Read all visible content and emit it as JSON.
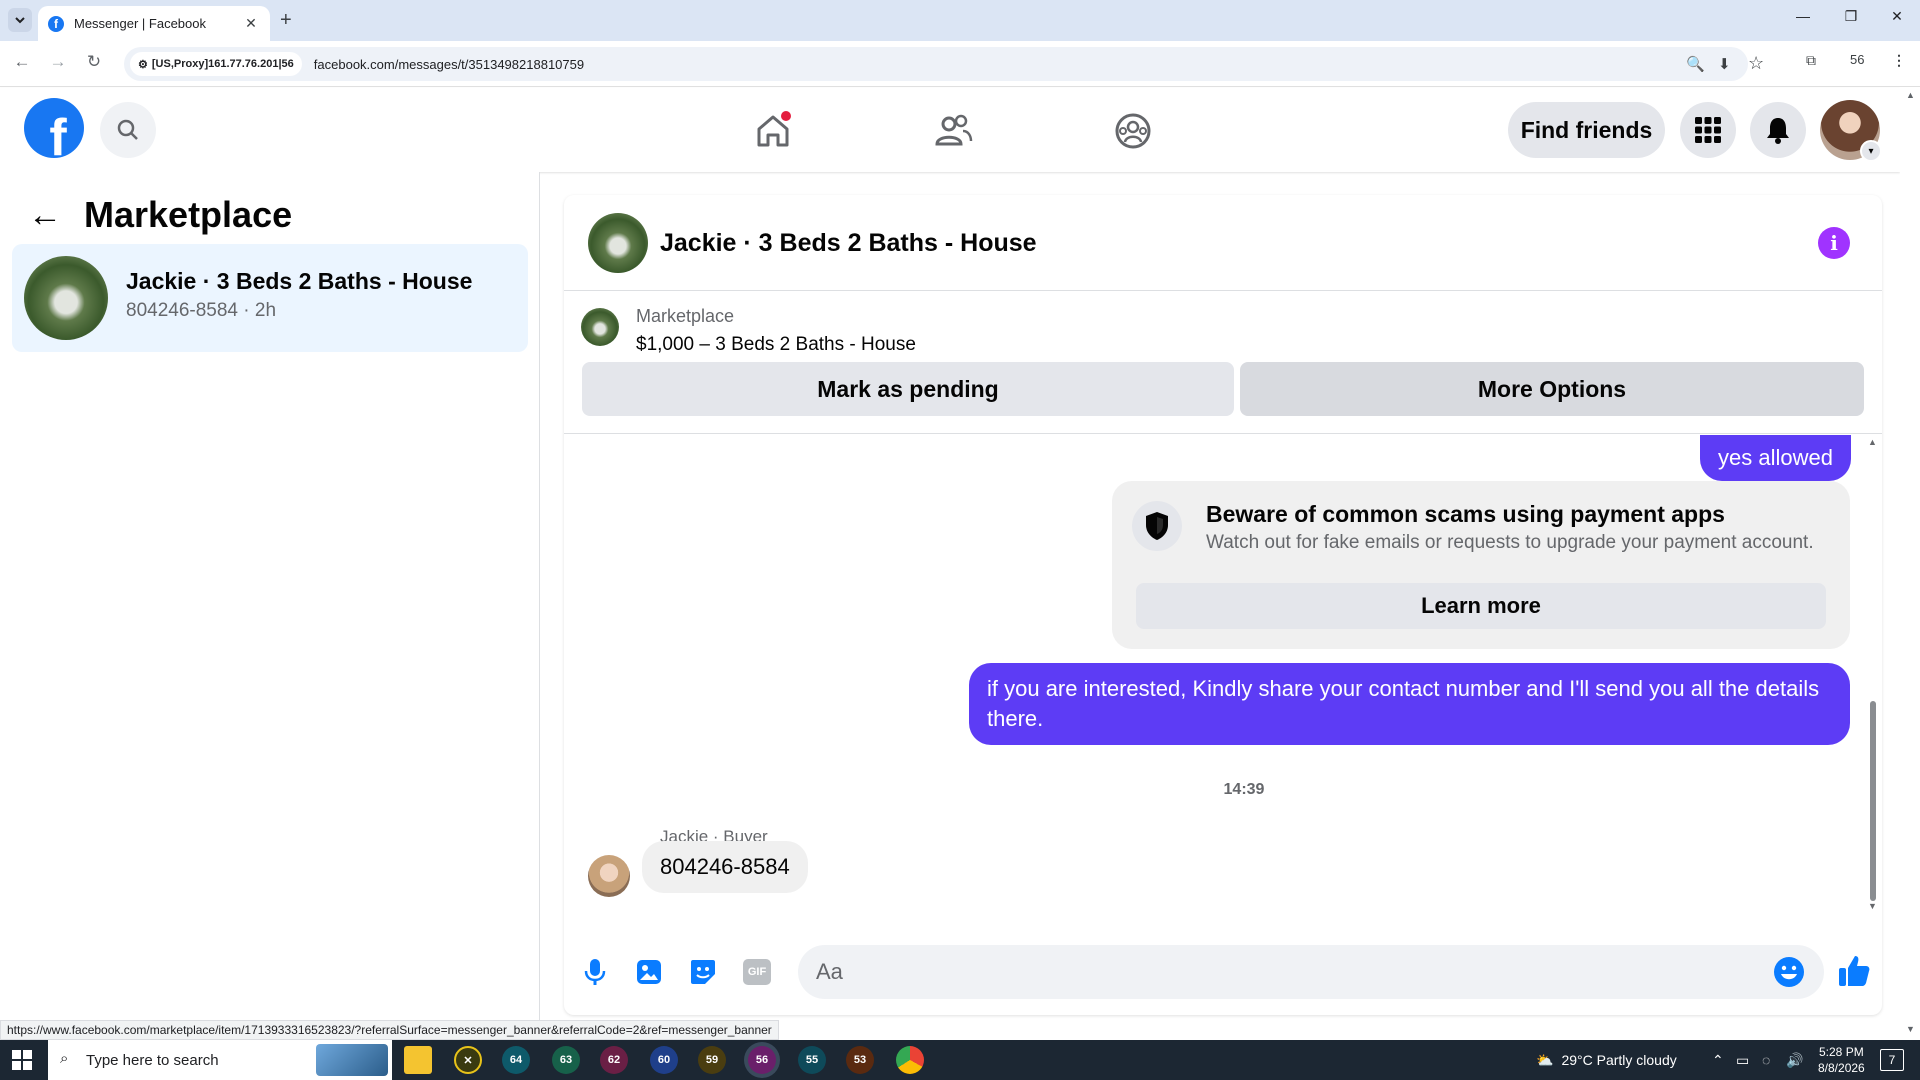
{
  "browser": {
    "tab_title": "Messenger | Facebook",
    "proxy_chip": "[US,Proxy]161.77.76.201|56",
    "url": "facebook.com/messages/t/3513498218810759",
    "profile_count": "56"
  },
  "fb_header": {
    "logo": "f",
    "find_friends": "Find friends"
  },
  "sidebar": {
    "title": "Marketplace",
    "conversation": {
      "name": "Jackie · 3 Beds 2 Baths - House",
      "meta": "804246-8584 · 2h"
    }
  },
  "chat": {
    "header_title": "Jackie · 3 Beds 2 Baths - House",
    "banner": {
      "label": "Marketplace",
      "listing": "$1,000 – 3 Beds 2 Baths - House",
      "mark_pending": "Mark as pending",
      "more_options": "More Options"
    },
    "messages": {
      "outgoing_1": "yes allowed",
      "scam_title": "Beware of common scams using payment apps",
      "scam_text": "Watch out for fake emails or requests to upgrade your payment account.",
      "learn_more": "Learn more",
      "outgoing_2": "if you are interested, Kindly share your contact number and I'll send you all the details there.",
      "timestamp": "14:39",
      "sender_label": "Jackie · Buyer",
      "incoming_1": "804246-8584"
    },
    "composer": {
      "placeholder": "Aa",
      "gif_label": "GIF"
    }
  },
  "status_url": "https://www.facebook.com/marketplace/item/1713933316523823/?referralSurface=messenger_banner&referralCode=2&ref=messenger_banner",
  "taskbar": {
    "search_placeholder": "Type here to search",
    "app_badges": [
      "64",
      "63",
      "62",
      "60",
      "59",
      "56",
      "55",
      "53"
    ],
    "weather": "29°C  Partly cloudy",
    "time": "5:28 PM",
    "date": "8/8/2026",
    "notifications": "7"
  },
  "colors": {
    "fb_blue": "#1877f2",
    "outgoing_bubble": "#5d3cf5",
    "info_purple": "#a033ff",
    "selected_conv": "#ebf5ff"
  }
}
